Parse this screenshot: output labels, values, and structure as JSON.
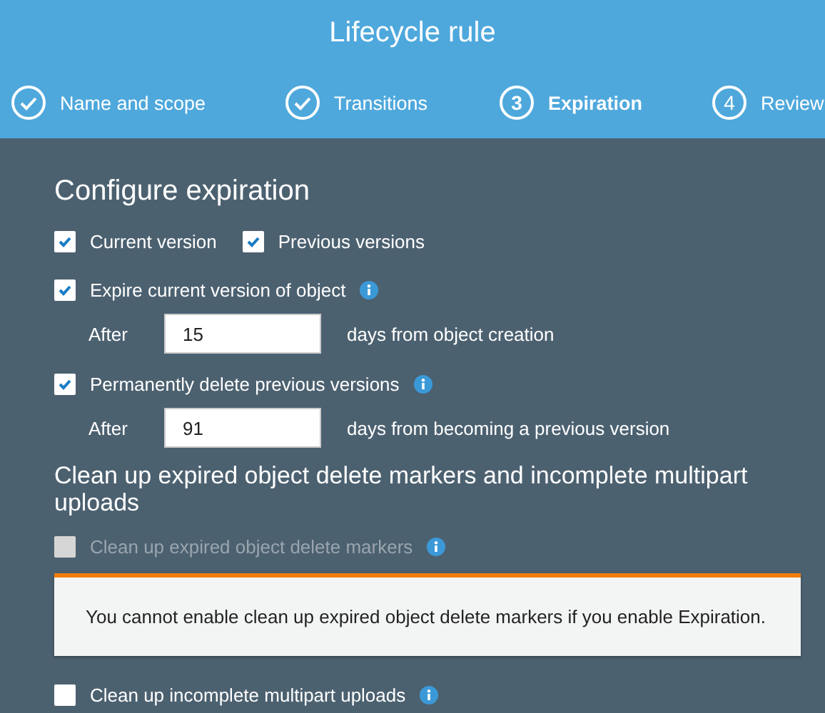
{
  "title": "Lifecycle rule",
  "steps": [
    {
      "label": "Name and scope",
      "done": true,
      "selected": false
    },
    {
      "label": "Transitions",
      "done": true,
      "selected": false
    },
    {
      "number": "3",
      "label": "Expiration",
      "done": false,
      "selected": true
    },
    {
      "number": "4",
      "label": "Review",
      "done": false,
      "selected": false
    }
  ],
  "heading": "Configure expiration",
  "versions": [
    {
      "label": "Current version",
      "checked": true
    },
    {
      "label": "Previous versions",
      "checked": true
    }
  ],
  "items": [
    {
      "kind": "checkbox",
      "label": "Expire current version of object",
      "checked": true,
      "disabled": false,
      "info": true
    },
    {
      "kind": "days",
      "label": "After",
      "value": "15",
      "suffix": "days from object creation"
    },
    {
      "kind": "checkbox",
      "label": "Permanently delete previous versions",
      "checked": true,
      "disabled": false,
      "info": true
    },
    {
      "kind": "days",
      "label": "After",
      "value": "91",
      "suffix": "days from becoming a previous version"
    },
    {
      "kind": "subheading",
      "label": "Clean up expired object delete markers and incomplete multipart uploads"
    },
    {
      "kind": "checkbox",
      "label": "Clean up expired object delete markers",
      "checked": false,
      "disabled": true,
      "info": true
    },
    {
      "kind": "warning",
      "label": "You cannot enable clean up expired object delete markers if you enable Expiration."
    },
    {
      "kind": "checkbox",
      "label": "Clean up incomplete multipart uploads",
      "checked": false,
      "disabled": false,
      "info": true
    }
  ]
}
